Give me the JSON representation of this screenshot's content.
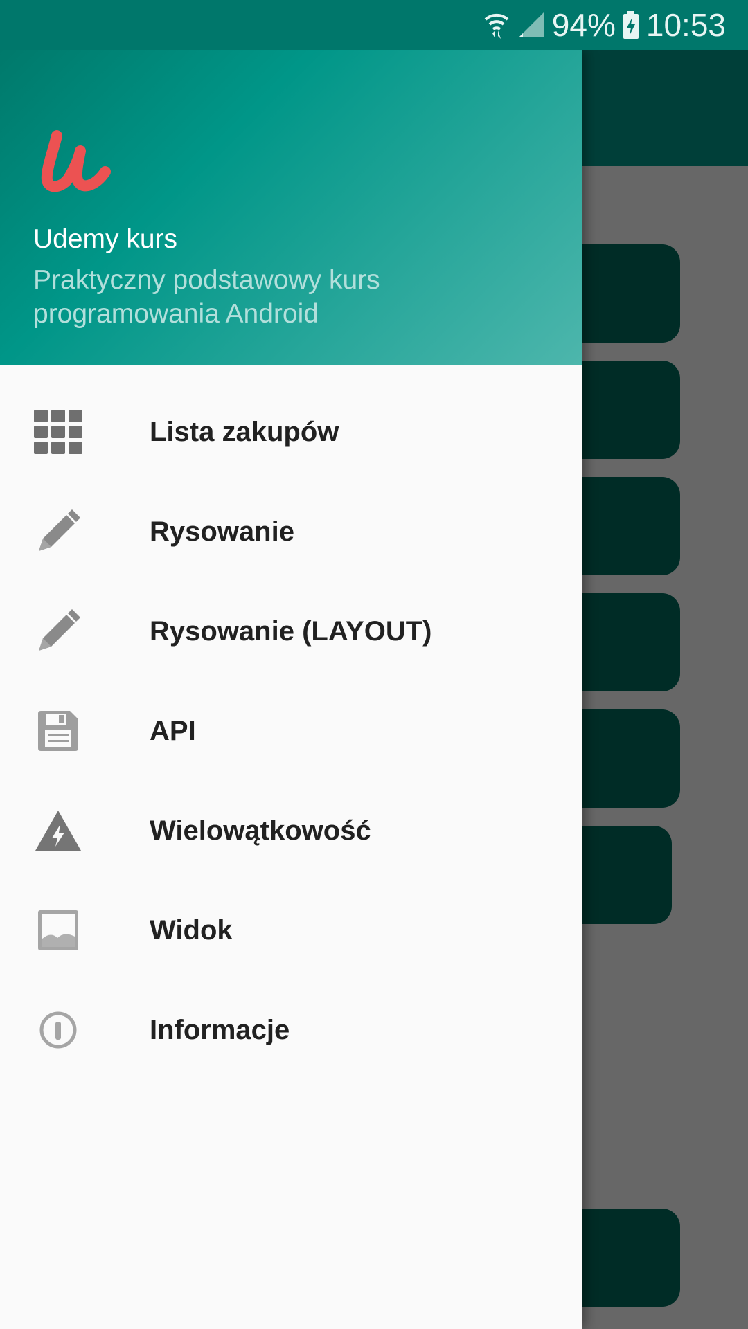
{
  "status_bar": {
    "battery": "94%",
    "time": "10:53"
  },
  "drawer": {
    "header": {
      "logo": "udemy-logo",
      "title": "Udemy kurs",
      "subtitle": "Praktyczny podstawowy kurs programowania Android"
    },
    "items": [
      {
        "label": "Lista zakupów",
        "icon": "grid-icon"
      },
      {
        "label": "Rysowanie",
        "icon": "pencil-icon"
      },
      {
        "label": "Rysowanie (LAYOUT)",
        "icon": "pencil-icon"
      },
      {
        "label": "API",
        "icon": "save-icon"
      },
      {
        "label": "Wielowątkowość",
        "icon": "flash-warning-icon"
      },
      {
        "label": "Widok",
        "icon": "image-icon"
      },
      {
        "label": "Informacje",
        "icon": "info-icon"
      }
    ]
  },
  "colors": {
    "primary": "#009688",
    "primary_dark": "#00796b",
    "accent_logo": "#ec5252",
    "icon_gray": "#8a8a8a"
  }
}
